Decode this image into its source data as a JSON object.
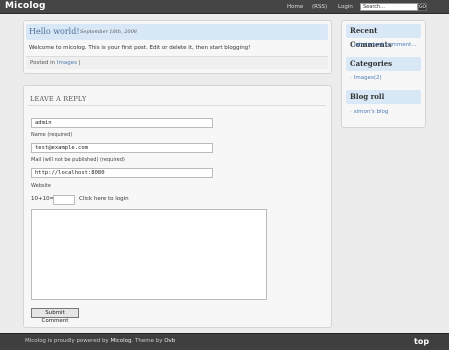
{
  "header": {
    "brand": "Micolog",
    "nav": [
      "Home",
      "(RSS)",
      "Login"
    ],
    "search_placeholder": "Search...",
    "search_button": "GO"
  },
  "post": {
    "title": "Hello world!",
    "date": "September 18th, 2008",
    "body": "Welcome to micolog. This is your first post. Edit or delete it, then start blogging!",
    "posted_in_label": "Posted in",
    "category": "Images",
    "separator": "|"
  },
  "reply": {
    "title": "LEAVE A REPLY",
    "name_value": "admin",
    "name_label": "Name (required)",
    "email_value": "test@example.com",
    "email_label": "Mail (will not be published) (required)",
    "website_value": "http://localhost:8080",
    "website_label": "Website",
    "captcha_label": "10+10=",
    "login_link": "Click here to login",
    "submit_label": "Submit Comment"
  },
  "sidebar": {
    "recent_comments": {
      "title": "Recent Comments",
      "items": [
        "admin:test comment..."
      ]
    },
    "categories": {
      "title": "Categories",
      "items": [
        "Images(2)"
      ]
    },
    "blogroll": {
      "title": "Blog roll",
      "items": [
        "simon's blog"
      ]
    }
  },
  "footer": {
    "text_prefix": "Micolog",
    "text_middle": " is proudly powered by ",
    "powered_by": "Micolog",
    "text_theme": ". Theme by ",
    "theme_author": "Ovb",
    "top_link": "top"
  },
  "colors": {
    "header_bg": "#454545",
    "title_bar": "#d9e8f6",
    "link": "#4a7bb7"
  }
}
